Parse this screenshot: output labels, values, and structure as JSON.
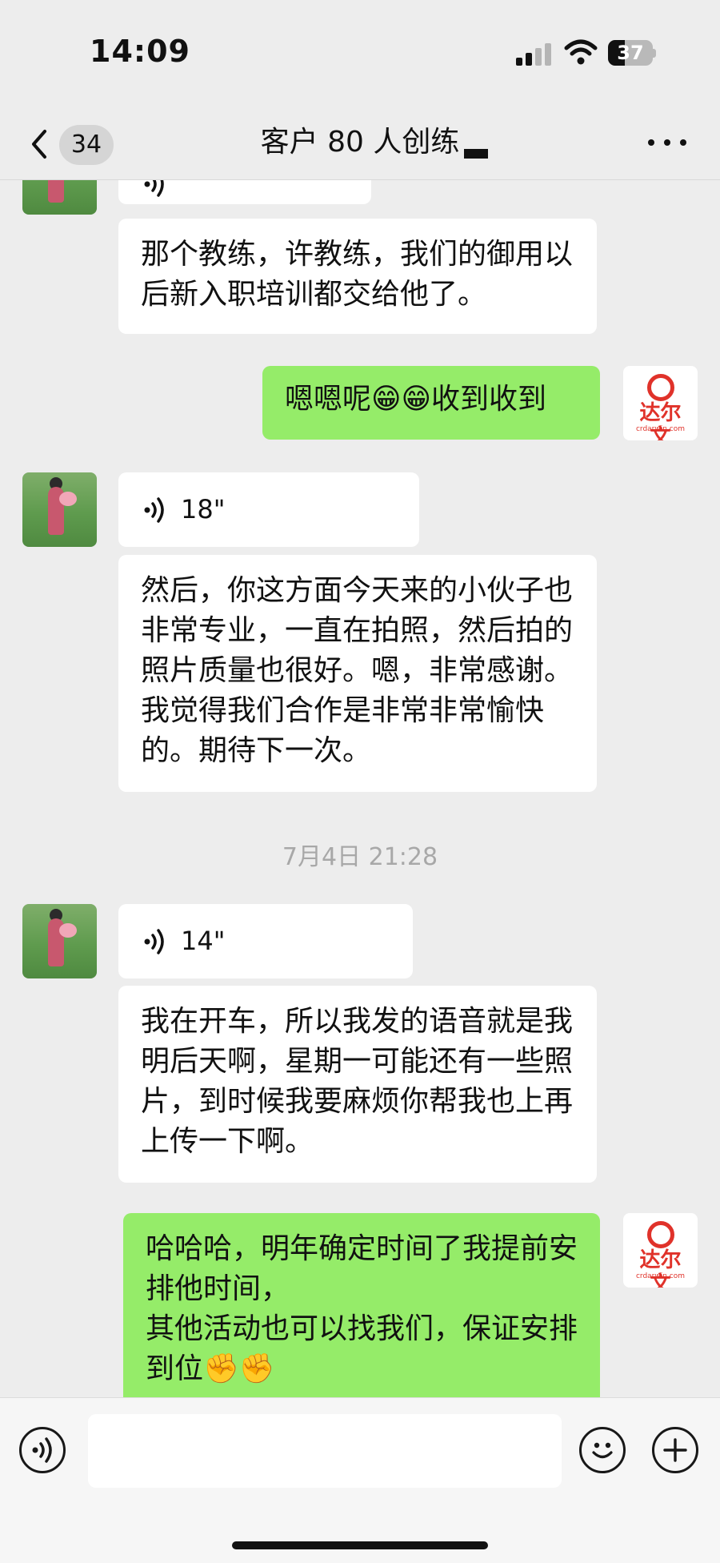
{
  "status_bar": {
    "time": "14:09",
    "battery": "37",
    "battery_level": 0.37
  },
  "header": {
    "back_count": "34",
    "title": "客户 80 人创练"
  },
  "messages": [
    {
      "type": "voice",
      "side": "left",
      "duration": ""
    },
    {
      "type": "text",
      "side": "left",
      "text": "那个教练，许教练，我们的御用以后新入职培训都交给他了。"
    },
    {
      "type": "text",
      "side": "right",
      "text": "嗯嗯呢😁😁收到收到"
    },
    {
      "type": "voice",
      "side": "left",
      "duration": "18\""
    },
    {
      "type": "text",
      "side": "left",
      "text": "然后，你这方面今天来的小伙子也非常专业，一直在拍照，然后拍的照片质量也很好。嗯，非常感谢。我觉得我们合作是非常非常愉快的。期待下一次。"
    },
    {
      "type": "timestamp",
      "text": "7月4日 21:28"
    },
    {
      "type": "voice",
      "side": "left",
      "duration": "14\""
    },
    {
      "type": "text",
      "side": "left",
      "text": "我在开车，所以我发的语音就是我明后天啊，星期一可能还有一些照片，到时候我要麻烦你帮我也上再上传一下啊。"
    },
    {
      "type": "text",
      "side": "right",
      "text": "哈哈哈，明年确定时间了我提前安排他时间，\n其他活动也可以找我们，保证安排到位✊✊"
    }
  ],
  "avatars": {
    "contact": {
      "icon": "photo-avatar"
    },
    "self": {
      "logo_text": "达尔文",
      "logo_sub": "crdarwin.com"
    }
  },
  "input_bar": {
    "voice_icon": "voice-mode-icon",
    "emoji_icon": "emoji-icon",
    "plus_icon": "plus-icon",
    "placeholder": ""
  },
  "colors": {
    "sent_bubble": "#95ec69",
    "received_bubble": "#ffffff",
    "background": "#ededed",
    "logo_red": "#e0322a"
  }
}
